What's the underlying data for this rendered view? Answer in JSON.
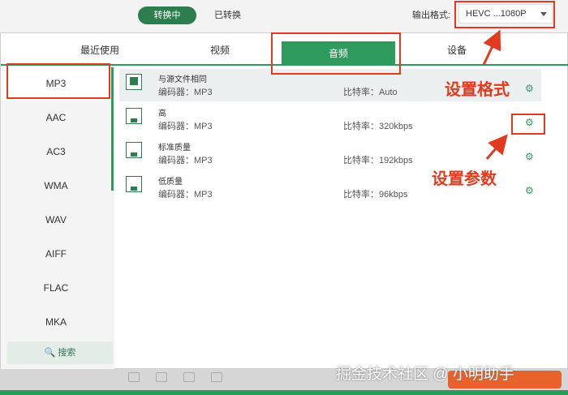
{
  "header": {
    "tab_converting": "转换中",
    "tab_converted": "已转换",
    "output_label": "输出格式:",
    "output_value": "HEVC ...1080P"
  },
  "categories": [
    "最近使用",
    "视频",
    "音频",
    "设备"
  ],
  "sidebar": {
    "items": [
      "MP3",
      "AAC",
      "AC3",
      "WMA",
      "WAV",
      "AIFF",
      "FLAC",
      "MKA"
    ],
    "search": "搜索"
  },
  "presets": [
    {
      "name": "与源文件相同",
      "encoder": "编码器：MP3",
      "bitrate": "比特率：Auto"
    },
    {
      "name": "高",
      "encoder": "编码器：MP3",
      "bitrate": "比特率：320kbps"
    },
    {
      "name": "标准质量",
      "encoder": "编码器：MP3",
      "bitrate": "比特率：192kbps"
    },
    {
      "name": "低质量",
      "encoder": "编码器：MP3",
      "bitrate": "比特率：96kbps"
    }
  ],
  "annotations": {
    "set_format": "设置格式",
    "set_params": "设置参数"
  },
  "watermark": "掘金技术社区 @ 小明助手",
  "colors": {
    "accent": "#2e9a5c",
    "annotation": "#e23a1e"
  }
}
